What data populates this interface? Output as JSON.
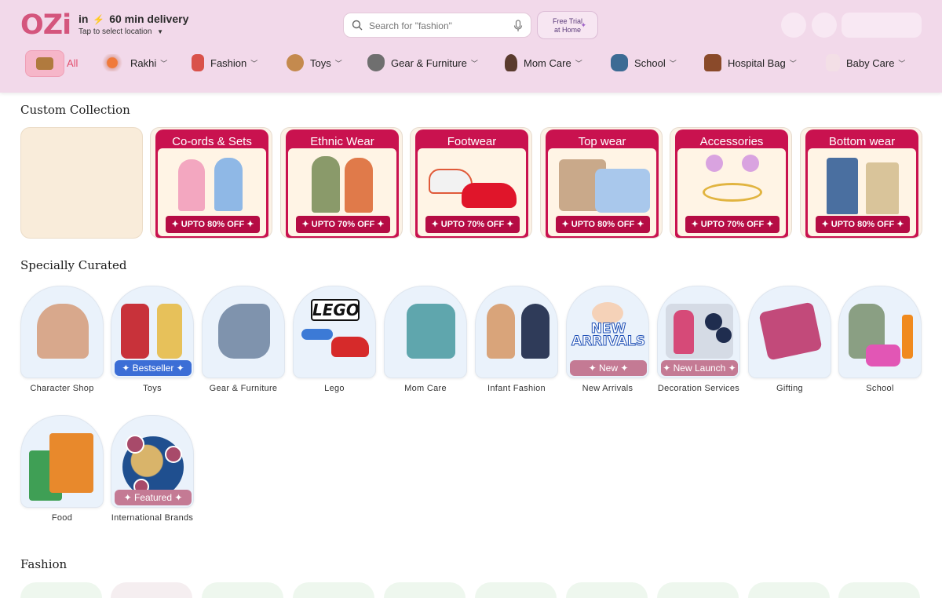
{
  "header": {
    "logo": "OZi",
    "delivery_prefix": "in",
    "delivery_bolt": "⚡",
    "delivery_text": "60 min delivery",
    "location": "Tap to select location",
    "search_placeholder": "Search for \"fashion\"",
    "free_trial_line1": "Free Trial",
    "free_trial_line2": "at Home"
  },
  "nav": {
    "items": [
      {
        "label": "All"
      },
      {
        "label": "Rakhi"
      },
      {
        "label": "Fashion"
      },
      {
        "label": "Toys"
      },
      {
        "label": "Gear & Furniture"
      },
      {
        "label": "Mom Care"
      },
      {
        "label": "School"
      },
      {
        "label": "Hospital Bag"
      },
      {
        "label": "Baby Care"
      }
    ]
  },
  "custom_collection": {
    "title": "Custom Collection",
    "cards": [
      {
        "title": "Co-ords & Sets",
        "offer": "✦ UPTO 80% OFF ✦"
      },
      {
        "title": "Ethnic Wear",
        "offer": "✦ UPTO 70% OFF ✦"
      },
      {
        "title": "Footwear",
        "offer": "✦ UPTO 70% OFF ✦"
      },
      {
        "title": "Top wear",
        "offer": "✦ UPTO 80% OFF ✦"
      },
      {
        "title": "Accessories",
        "offer": "✦ UPTO 70% OFF ✦"
      },
      {
        "title": "Bottom wear",
        "offer": "✦ UPTO 80% OFF ✦"
      }
    ]
  },
  "specially_curated": {
    "title": "Specially Curated",
    "items": [
      {
        "label": "Character Shop",
        "badge": ""
      },
      {
        "label": "Toys",
        "badge": "✦ Bestseller ✦"
      },
      {
        "label": "Gear & Furniture",
        "badge": ""
      },
      {
        "label": "Lego",
        "badge": ""
      },
      {
        "label": "Mom Care",
        "badge": ""
      },
      {
        "label": "Infant Fashion",
        "badge": ""
      },
      {
        "label": "New Arrivals",
        "badge": "✦ New ✦"
      },
      {
        "label": "Decoration Services",
        "badge": "✦ New Launch ✦"
      },
      {
        "label": "Gifting",
        "badge": ""
      },
      {
        "label": "School",
        "badge": ""
      },
      {
        "label": "Food",
        "badge": ""
      },
      {
        "label": "International Brands",
        "badge": "✦ Featured ✦"
      }
    ]
  },
  "fashion": {
    "title": "Fashion"
  },
  "colors": {
    "brand": "#d4557d",
    "header_bg": "#f2d9ea",
    "collection_red": "#c9124f",
    "badge_blue": "#3c6ed6",
    "badge_pink": "#c47a94"
  }
}
